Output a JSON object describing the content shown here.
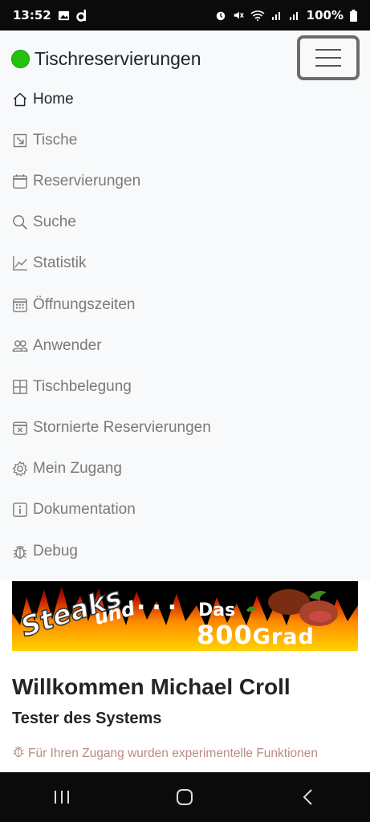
{
  "status_bar": {
    "time": "13:52",
    "battery": "100%",
    "icons_left": [
      "image-icon",
      "d-app-icon"
    ],
    "icons_right": [
      "alarm-icon",
      "mute-icon",
      "wifi-icon",
      "signal-icon",
      "signal-icon-2",
      "battery-icon"
    ]
  },
  "navbar": {
    "brand": "Tischreservierungen",
    "status_color": "#22c30a",
    "items": [
      {
        "label": "Home",
        "icon": "house-icon",
        "active": true
      },
      {
        "label": "Tische",
        "icon": "arrow-down-right-square-icon"
      },
      {
        "label": "Reservierungen",
        "icon": "calendar-icon"
      },
      {
        "label": "Suche",
        "icon": "search-icon"
      },
      {
        "label": "Statistik",
        "icon": "graph-up-icon"
      },
      {
        "label": "Öffnungszeiten",
        "icon": "calendar-grid-icon"
      },
      {
        "label": "Anwender",
        "icon": "people-icon"
      },
      {
        "label": "Tischbelegung",
        "icon": "grid-icon"
      },
      {
        "label": "Stornierte Reservierungen",
        "icon": "calendar-x-icon"
      },
      {
        "label": "Mein Zugang",
        "icon": "gear-icon"
      },
      {
        "label": "Dokumentation",
        "icon": "info-square-icon"
      },
      {
        "label": "Debug",
        "icon": "bug-icon"
      }
    ]
  },
  "banner": {
    "line1": "Steaks",
    "line2": "und",
    "dots": "...",
    "line3": "Das",
    "line4": "800",
    "line4b": "Grad"
  },
  "main": {
    "welcome": "Willkommen Michael Croll",
    "role": "Tester des Systems",
    "note": "Für Ihren Zugang wurden experimentelle Funktionen"
  }
}
